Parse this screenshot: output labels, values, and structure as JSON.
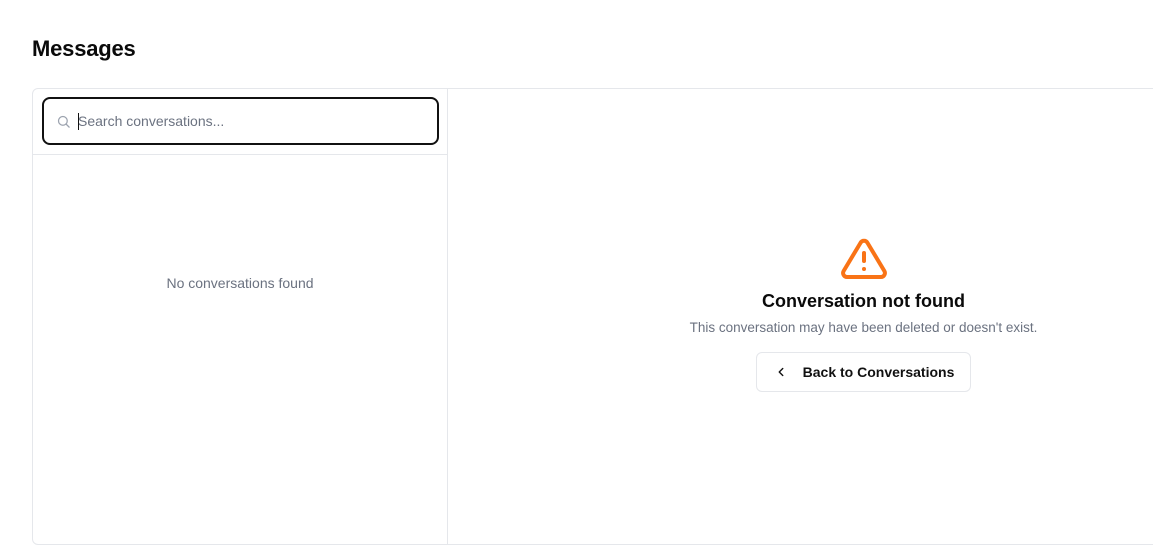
{
  "page": {
    "title": "Messages"
  },
  "sidebar": {
    "search": {
      "placeholder": "Search conversations...",
      "value": "",
      "icon": "search-icon"
    },
    "empty_text": "No conversations found"
  },
  "main": {
    "status": {
      "icon": "warning-triangle-icon",
      "icon_color": "#f97316",
      "title": "Conversation not found",
      "description": "This conversation may have been deleted or doesn't exist."
    },
    "back_button": {
      "label": "Back to Conversations",
      "icon": "chevron-left-icon"
    }
  }
}
